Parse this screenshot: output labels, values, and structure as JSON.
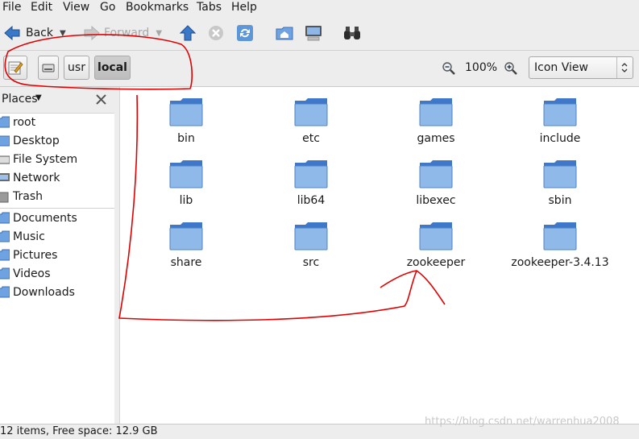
{
  "menu": [
    "File",
    "Edit",
    "View",
    "Go",
    "Bookmarks",
    "Tabs",
    "Help"
  ],
  "toolbar": {
    "back_label": "Back",
    "forward_label": "Forward"
  },
  "location": {
    "crumbs": [
      "usr",
      "local"
    ],
    "zoom": "100%",
    "view_mode": "Icon View"
  },
  "sidebar": {
    "header": "Places",
    "places": [
      "root",
      "Desktop",
      "File System",
      "Network",
      "Trash"
    ],
    "bookmarks": [
      "Documents",
      "Music",
      "Pictures",
      "Videos",
      "Downloads"
    ]
  },
  "files": [
    "bin",
    "etc",
    "games",
    "include",
    "lib",
    "lib64",
    "libexec",
    "sbin",
    "share",
    "src",
    "zookeeper",
    "zookeeper-3.4.13"
  ],
  "status": "12 items, Free space: 12.9 GB",
  "watermark": "https://blog.csdn.net/warrenhua2008",
  "colors": {
    "folder_light": "#8fb9e8",
    "folder_dark": "#3f78c8",
    "annotation": "#e00000"
  }
}
